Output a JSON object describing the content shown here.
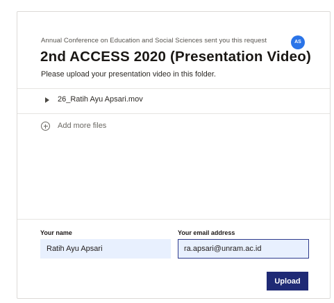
{
  "page": {
    "edge_fragment": "‘"
  },
  "request": {
    "requester_line": "Annual Conference on Education and Social Sciences sent you this request",
    "avatar_initials": "AS",
    "title": "2nd ACCESS 2020 (Presentation Video)",
    "description": "Please upload your presentation video in this folder."
  },
  "files": [
    {
      "name": "26_Ratih Ayu Apsari.mov",
      "icon": "play-icon"
    }
  ],
  "add_files": {
    "label": "Add more files",
    "icon": "plus-circle-icon"
  },
  "form": {
    "name_label": "Your name",
    "name_value": "Ratih Ayu Apsari",
    "email_label": "Your email address",
    "email_value": "ra.apsari@unram.ac.id",
    "upload_label": "Upload"
  },
  "colors": {
    "avatar": "#2a74e8",
    "upload_button": "#1f2a75",
    "input_fill": "#e8f0fe",
    "focus_border": "#2d3a8c"
  }
}
